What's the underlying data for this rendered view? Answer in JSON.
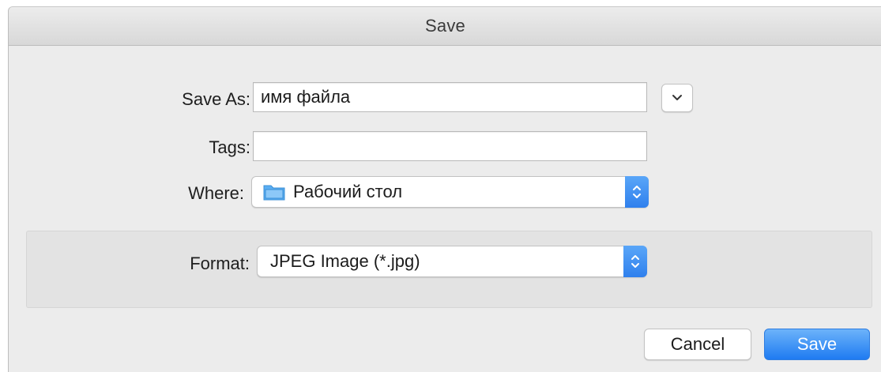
{
  "dialog": {
    "title": "Save"
  },
  "form": {
    "save_as_label": "Save As:",
    "save_as_value": "имя файла",
    "tags_label": "Tags:",
    "tags_value": "",
    "where_label": "Where:",
    "where_value": "Рабочий стол",
    "where_icon": "folder-icon"
  },
  "format": {
    "label": "Format:",
    "value": "JPEG Image (*.jpg)"
  },
  "buttons": {
    "cancel": "Cancel",
    "save": "Save"
  },
  "colors": {
    "accent": "#2f80ed",
    "folder": "#5aaef3"
  }
}
